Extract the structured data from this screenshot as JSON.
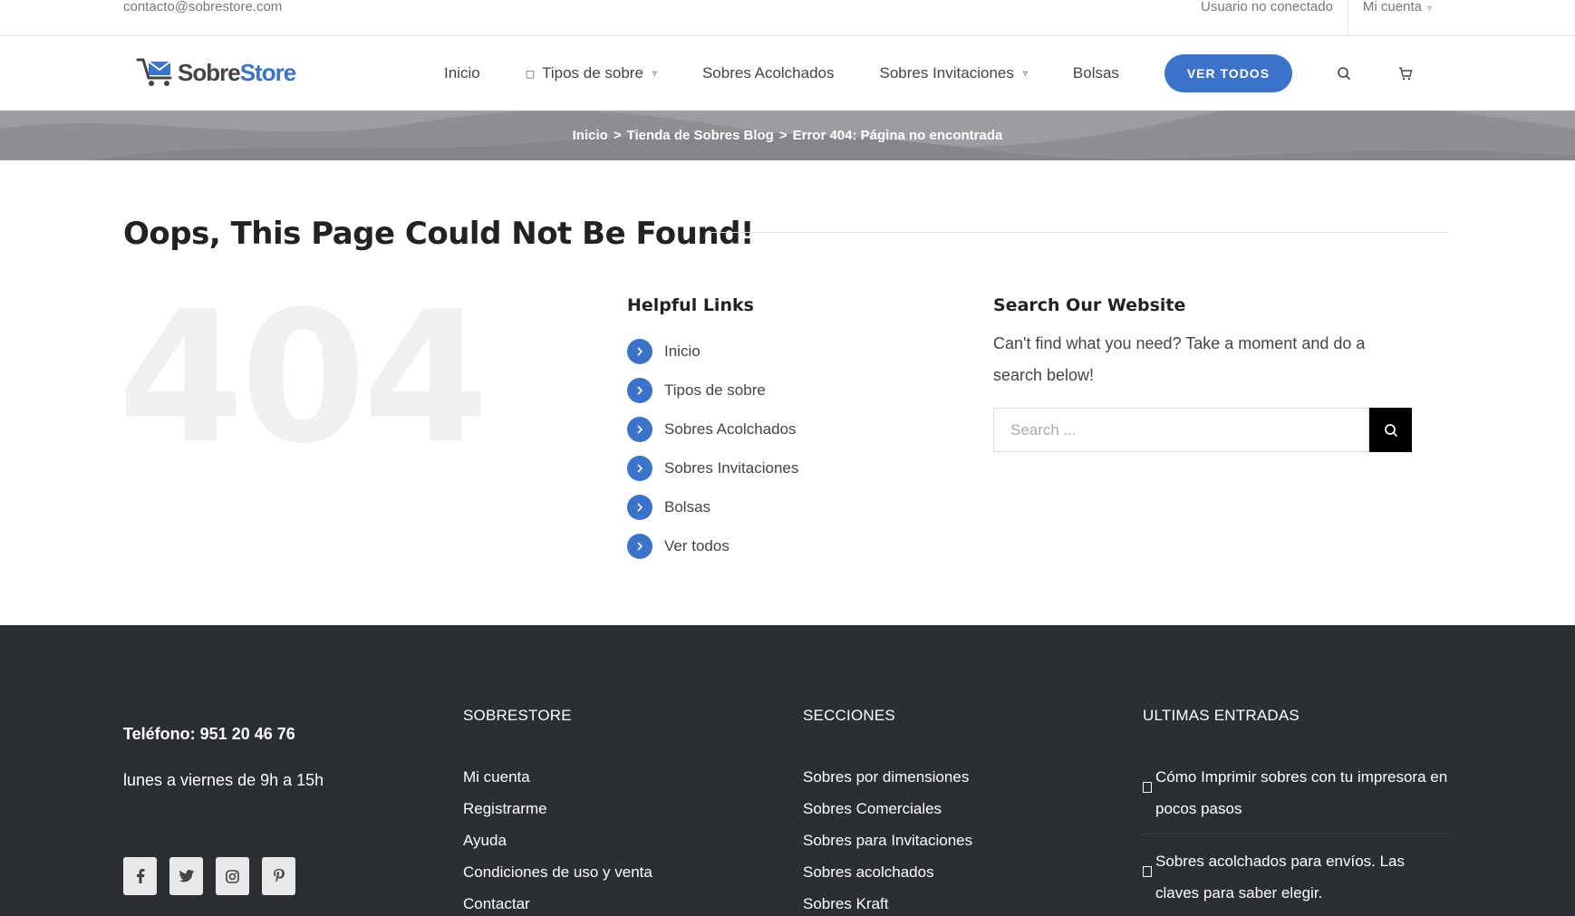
{
  "topbar": {
    "email": "contacto@sobrestore.com",
    "user_status": "Usuario no conectado",
    "account": "Mi cuenta"
  },
  "header": {
    "logo_text_1": "Sobre",
    "logo_text_2": "Store",
    "nav": [
      {
        "label": "Inicio"
      },
      {
        "label": "Tipos de sobre"
      },
      {
        "label": "Sobres Acolchados"
      },
      {
        "label": "Sobres Invitaciones"
      },
      {
        "label": "Bolsas"
      }
    ],
    "cta": "VER TODOS",
    "icons": [
      "search-icon",
      "cart-icon"
    ]
  },
  "breadcrumb": {
    "items": [
      "Inicio",
      "Tienda de Sobres Blog",
      "Error 404: Página no encontrada"
    ],
    "separator": ">"
  },
  "error": {
    "title": "Oops, This Page Could Not Be Found!",
    "code": "404"
  },
  "helpful": {
    "title": "Helpful Links",
    "links": [
      "Inicio",
      "Tipos de sobre",
      "Sobres Acolchados",
      "Sobres Invitaciones",
      "Bolsas",
      "Ver todos"
    ]
  },
  "search": {
    "title": "Search Our Website",
    "text": "Can't find what you need? Take a moment and do a search below!",
    "placeholder": "Search ..."
  },
  "footer": {
    "phone": "Teléfono: 951 20 46 76",
    "hours": "lunes a viernes de 9h a 15h",
    "socials": [
      "facebook-icon",
      "twitter-icon",
      "instagram-icon",
      "pinterest-icon"
    ],
    "col2": {
      "title": "SOBRESTORE",
      "items": [
        "Mi cuenta",
        "Registrarme",
        "Ayuda",
        "Condiciones de uso y venta",
        "Contactar"
      ]
    },
    "col3": {
      "title": "SECCIONES",
      "items": [
        "Sobres por dimensiones",
        "Sobres Comerciales",
        "Sobres para Invitaciones",
        "Sobres acolchados",
        "Sobres Kraft"
      ]
    },
    "col4": {
      "title": "ULTIMAS ENTRADAS",
      "posts": [
        "Cómo Imprimir sobres con tu impresora en pocos pasos",
        "Sobres acolchados para envíos. Las claves para saber elegir."
      ]
    }
  },
  "colors": {
    "accent": "#3a73c9",
    "band": "#8e8f93",
    "footer": "#2b2e33"
  }
}
